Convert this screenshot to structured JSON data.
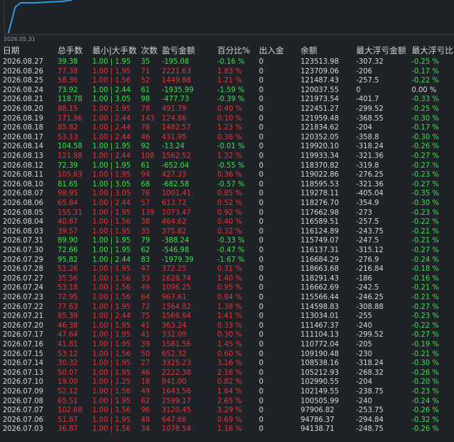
{
  "chart": {
    "date_label": "2026.05.31",
    "line_color": "#2f9ae8"
  },
  "headers": {
    "date": "日期",
    "total_lots": "总手数",
    "min_max_lots": "最小|大手数",
    "count": "次数",
    "pl": "盈亏金额",
    "pct": "百分比%",
    "in_out": "出入金",
    "balance": "余额",
    "max_float_amt": "最大浮亏金额",
    "max_float_pct": "最大浮亏比"
  },
  "colors": {
    "profit": "#e0343c",
    "loss": "#39e24a"
  },
  "rows": [
    [
      "2026.08.27",
      "39.38",
      "1.00 | 1.95",
      "35",
      "-195.08",
      "-0.16 %",
      "0",
      "123513.98",
      "-307.32",
      "-0.25 %"
    ],
    [
      "2026.08.26",
      "77.38",
      "1.00 | 1.95",
      "71",
      "2221.63",
      "1.83 %",
      "0",
      "123709.06",
      "-206",
      "-0.17 %"
    ],
    [
      "2026.08.25",
      "58.36",
      "1.00 | 1.56",
      "52",
      "1449.88",
      "1.21 %",
      "0",
      "121487.43",
      "-257.5",
      "-0.22 %"
    ],
    [
      "2026.08.24",
      "73.92",
      "1.00 | 2.44",
      "61",
      "-1935.99",
      "-1.59 %",
      "0",
      "120037.55",
      "0",
      "0.00 %"
    ],
    [
      "2026.08.21",
      "118.78",
      "1.00 | 3.05",
      "98",
      "-477.73",
      "-0.39 %",
      "0",
      "121973.54",
      "-401.7",
      "-0.33 %"
    ],
    [
      "2026.08.20",
      "88.15",
      "1.00 | 1.95",
      "78",
      "491.79",
      "0.40 %",
      "0",
      "122451.27",
      "-299.52",
      "-0.25 %"
    ],
    [
      "2026.08.19",
      "171.96",
      "1.00 | 2.44",
      "143",
      "124.86",
      "0.10 %",
      "0",
      "121959.48",
      "-368.55",
      "-0.30 %"
    ],
    [
      "2026.08.18",
      "85.82",
      "1.00 | 2.44",
      "78",
      "1482.57",
      "1.23 %",
      "0",
      "121834.62",
      "-204",
      "-0.17 %"
    ],
    [
      "2026.08.17",
      "53.13",
      "1.00 | 2.44",
      "46",
      "431.95",
      "0.36 %",
      "0",
      "120352.05",
      "-358.8",
      "-0.30 %"
    ],
    [
      "2026.08.14",
      "104.58",
      "1.00 | 1.95",
      "92",
      "-13.24",
      "-0.01 %",
      "0",
      "119920.10",
      "-318.24",
      "-0.26 %"
    ],
    [
      "2026.08.13",
      "121.88",
      "1.00 | 2.44",
      "108",
      "1562.52",
      "1.32 %",
      "0",
      "119933.34",
      "-321.36",
      "-0.27 %"
    ],
    [
      "2026.08.12",
      "72.39",
      "1.00 | 1.95",
      "61",
      "-652.04",
      "-0.55 %",
      "0",
      "118370.82",
      "-319.8",
      "-0.27 %"
    ],
    [
      "2026.08.11",
      "105.63",
      "1.00 | 1.95",
      "94",
      "427.33",
      "0.36 %",
      "0",
      "119022.86",
      "-276.25",
      "-0.23 %"
    ],
    [
      "2026.08.10",
      "81.65",
      "1.00 | 3.05",
      "68",
      "-682.58",
      "-0.57 %",
      "0",
      "118595.53",
      "-321.36",
      "-0.27 %"
    ],
    [
      "2026.08.07",
      "98.95",
      "1.00 | 3.05",
      "76",
      "1001.41",
      "0.85 %",
      "0",
      "119278.11",
      "-405.04",
      "-0.35 %"
    ],
    [
      "2026.08.06",
      "65.84",
      "1.00 | 2.44",
      "57",
      "613.72",
      "0.52 %",
      "0",
      "118276.70",
      "-354.9",
      "-0.30 %"
    ],
    [
      "2026.08.05",
      "155.31",
      "1.00 | 1.95",
      "139",
      "1073.47",
      "0.92 %",
      "0",
      "117662.98",
      "-273",
      "-0.23 %"
    ],
    [
      "2026.08.04",
      "40.87",
      "1.00 | 1.56",
      "38",
      "464.62",
      "0.40 %",
      "0",
      "116589.51",
      "-257.5",
      "-0.22 %"
    ],
    [
      "2026.08.03",
      "39.57",
      "1.00 | 1.95",
      "35",
      "375.82",
      "0.32 %",
      "0",
      "116124.89",
      "-243.75",
      "-0.21 %"
    ],
    [
      "2026.07.31",
      "89.90",
      "1.00 | 1.95",
      "79",
      "-388.24",
      "-0.33 %",
      "0",
      "115749.07",
      "-247.5",
      "-0.21 %"
    ],
    [
      "2026.07.30",
      "72.66",
      "1.00 | 1.95",
      "62",
      "-546.98",
      "-0.47 %",
      "0",
      "116137.31",
      "-315.12",
      "-0.27 %"
    ],
    [
      "2026.07.29",
      "95.82",
      "1.00 | 2.44",
      "83",
      "-1979.39",
      "-1.67 %",
      "0",
      "116684.29",
      "-276.9",
      "-0.24 %"
    ],
    [
      "2026.07.28",
      "51.26",
      "1.00 | 1.95",
      "47",
      "372.25",
      "0.31 %",
      "0",
      "118663.68",
      "-216.84",
      "-0.18 %"
    ],
    [
      "2026.07.27",
      "35.56",
      "1.00 | 1.56",
      "33",
      "1628.74",
      "1.40 %",
      "0",
      "118291.43",
      "-186",
      "-0.16 %"
    ],
    [
      "2026.07.24",
      "53.18",
      "1.00 | 1.56",
      "49",
      "1096.25",
      "0.95 %",
      "0",
      "116662.69",
      "-242.5",
      "-0.21 %"
    ],
    [
      "2026.07.23",
      "72.95",
      "1.00 | 1.56",
      "64",
      "967.61",
      "0.84 %",
      "0",
      "115566.44",
      "-246.25",
      "-0.21 %"
    ],
    [
      "2026.07.22",
      "77.63",
      "1.00 | 1.95",
      "72",
      "1564.82",
      "1.38 %",
      "0",
      "114598.83",
      "-308.88",
      "-0.27 %"
    ],
    [
      "2026.07.21",
      "85.39",
      "1.00 | 2.44",
      "75",
      "1566.64",
      "1.41 %",
      "0",
      "113034.01",
      "-255",
      "-0.23 %"
    ],
    [
      "2026.07.20",
      "46.38",
      "1.00 | 1.95",
      "41",
      "363.24",
      "0.33 %",
      "0",
      "111467.37",
      "-240",
      "-0.22 %"
    ],
    [
      "2026.07.17",
      "47.64",
      "1.00 | 1.95",
      "41",
      "332.09",
      "0.30 %",
      "0",
      "111104.13",
      "-299.52",
      "-0.27 %"
    ],
    [
      "2026.07.16",
      "41.81",
      "1.00 | 1.95",
      "39",
      "1581.56",
      "1.45 %",
      "0",
      "110772.04",
      "-205",
      "-0.19 %"
    ],
    [
      "2026.07.15",
      "53.12",
      "1.00 | 1.56",
      "50",
      "652.32",
      "0.60 %",
      "0",
      "109190.48",
      "-230",
      "-0.21 %"
    ],
    [
      "2026.07.14",
      "30.32",
      "1.00 | 1.95",
      "27",
      "3325.23",
      "3.16 %",
      "0",
      "108538.16",
      "-318.24",
      "-0.30 %"
    ],
    [
      "2026.07.13",
      "50.07",
      "1.00 | 1.95",
      "46",
      "2222.38",
      "2.16 %",
      "0",
      "105212.93",
      "-268.32",
      "-0.26 %"
    ],
    [
      "2026.07.10",
      "19.00",
      "1.00 | 1.25",
      "18",
      "841.00",
      "0.82 %",
      "0",
      "102990.55",
      "-204",
      "-0.20 %"
    ],
    [
      "2026.07.09",
      "52.12",
      "1.00 | 1.56",
      "49",
      "1643.56",
      "1.64 %",
      "0",
      "102149.55",
      "-238.75",
      "-0.23 %"
    ],
    [
      "2026.07.08",
      "65.51",
      "1.00 | 1.95",
      "62",
      "2599.17",
      "2.65 %",
      "0",
      "100505.99",
      "-240",
      "-0.24 %"
    ],
    [
      "2026.07.07",
      "102.68",
      "1.00 | 1.56",
      "96",
      "3120.45",
      "3.29 %",
      "0",
      "97906.82",
      "-253.75",
      "-0.26 %"
    ],
    [
      "2026.07.06",
      "51.87",
      "1.00 | 1.95",
      "48",
      "647.66",
      "0.69 %",
      "0",
      "94786.37",
      "-294.84",
      "-0.32 %"
    ],
    [
      "2026.07.03",
      "36.87",
      "1.00 | 1.56",
      "34",
      "1078.54",
      "1.16 %",
      "0",
      "94138.71",
      "-248.75",
      "-0.26 %"
    ]
  ]
}
